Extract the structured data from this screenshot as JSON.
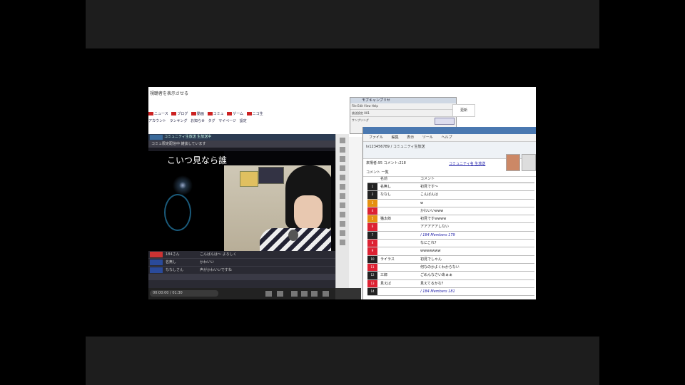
{
  "browser": {
    "heading": "視聴者を表示させる",
    "row1": [
      "ニュース",
      "ブログ",
      "動画",
      "コミュ",
      "ゲーム",
      "ニコ生"
    ],
    "row2": [
      "アカウント",
      "ランキング",
      "お知らせ",
      "タグ",
      "マイページ",
      "設定"
    ]
  },
  "player": {
    "title": "コミュニティ生放送 生放送中",
    "subtitle": "コミュ限定配信中 雑談しています",
    "overlay_text": "こいつ見なら誰",
    "comments": [
      {
        "name": "184さん",
        "msg": "こんばんは〜 よろしく"
      },
      {
        "name": "名無し",
        "msg": "かわいい"
      },
      {
        "name": "ななしさん",
        "msg": "声がかわいいですね"
      }
    ],
    "time_display": "00:00:00 / 01:30"
  },
  "float_window": {
    "title": "モブキャンプリセ",
    "menu": "File Edit View Help",
    "row1": "放送設定 001",
    "row2": "サンプリング",
    "button": "設定"
  },
  "mini_card": "更新",
  "viewer": {
    "menu": [
      "ファイル",
      "編集",
      "表示",
      "ツール",
      "ヘルプ"
    ],
    "url": "lv123456789 / コミュニティ生放送",
    "status_left": "来場者:95 コメント:218",
    "status_link": "コミュニティ名 生放送",
    "tabs": "コメント 一覧",
    "header_name": "名前",
    "header_msg": "コメント",
    "rows": [
      {
        "badge": "1",
        "color": "black",
        "name": "名無し",
        "msg": "初見です〜",
        "blue": false
      },
      {
        "badge": "2",
        "color": "black",
        "name": "ななし",
        "msg": "こんばんは",
        "blue": false
      },
      {
        "badge": "3",
        "color": "orange",
        "name": "",
        "msg": "w",
        "blue": false
      },
      {
        "badge": "4",
        "color": "red",
        "name": "",
        "msg": "かわいいwww",
        "blue": false
      },
      {
        "badge": "5",
        "color": "orange",
        "name": "猫太郎",
        "msg": "初見ですwwww",
        "blue": false
      },
      {
        "badge": "6",
        "color": "red",
        "name": "",
        "msg": "アアアアアしない",
        "blue": false
      },
      {
        "badge": "7",
        "color": "black",
        "name": "",
        "msg": "/ 184 Members 179",
        "blue": true
      },
      {
        "badge": "8",
        "color": "red",
        "name": "",
        "msg": "なにこれ？",
        "blue": false
      },
      {
        "badge": "9",
        "color": "red",
        "name": "",
        "msg": "wwwwwww",
        "blue": false
      },
      {
        "badge": "10",
        "color": "black",
        "name": "ライラス",
        "msg": "初見でしゃん",
        "blue": false
      },
      {
        "badge": "11",
        "color": "red",
        "name": "",
        "msg": "何なのかよくわからない",
        "blue": false
      },
      {
        "badge": "12",
        "color": "black",
        "name": "三郎",
        "msg": "ごめんなさいあぁぁ",
        "blue": false
      },
      {
        "badge": "13",
        "color": "red",
        "name": "見えば",
        "msg": "見えてるかな？",
        "blue": false
      },
      {
        "badge": "14",
        "color": "black",
        "name": "",
        "msg": "/ 184 Members 181",
        "blue": true
      }
    ]
  },
  "colors": {
    "badge_black": "#222222",
    "badge_red": "#dd2233",
    "badge_orange": "#e59010",
    "titlebar": "#4a78b0"
  }
}
